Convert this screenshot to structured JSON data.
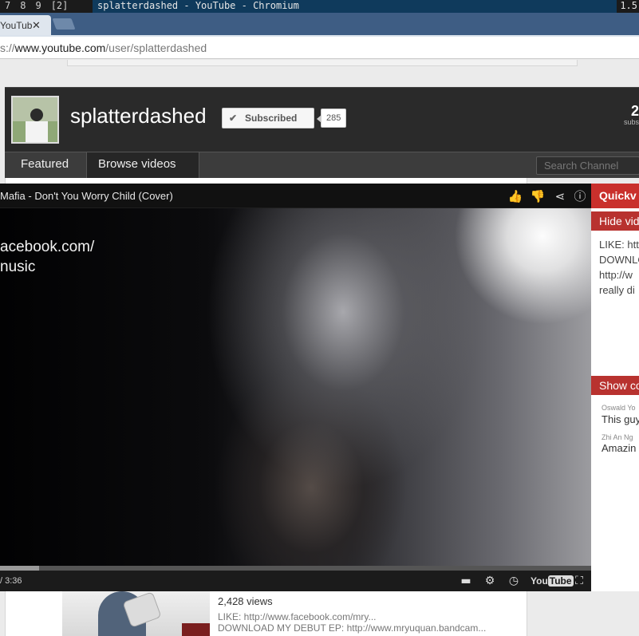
{
  "wm": {
    "tags": [
      "7",
      "8",
      "9",
      "[2]"
    ],
    "window_title": "splatterdashed - YouTube - Chromium",
    "right_text": "1.5"
  },
  "browser": {
    "tab_label": "YouTub",
    "url_prefix": "s://",
    "url_host": "www.youtube.com",
    "url_path": "/user/splatterdashed"
  },
  "channel": {
    "name": "splatterdashed",
    "subscribe_label": "Subscribed",
    "subscriber_count": "285",
    "total_subs_value": "2",
    "total_subs_label": "subs",
    "nav": [
      "Featured",
      "Browse videos"
    ],
    "search_placeholder": "Search Channel"
  },
  "player": {
    "title": "Mafia - Don't You Worry Child (Cover)",
    "overlay_text": "acebook.com/\nnusic",
    "time": "/ 3:36",
    "progress_fraction": 0.066,
    "logo_you": "You",
    "logo_tube": "Tube"
  },
  "quickview": {
    "header": "Quickv",
    "hide_label": "Hide vid",
    "description": "LIKE: htt\nDOWNLO\nhttp://w\nreally di",
    "show_comments_label": "Show co",
    "comments": [
      {
        "author": "Oswald Yo",
        "text": "This guy"
      },
      {
        "author": "Zhi An Ng",
        "text": "Amazin"
      }
    ]
  },
  "video_row": {
    "views": "2,428 views",
    "desc_line1": "LIKE: http://www.facebook.com/mry...",
    "desc_line2": "DOWNLOAD MY DEBUT EP: http://www.mryuquan.bandcam..."
  }
}
